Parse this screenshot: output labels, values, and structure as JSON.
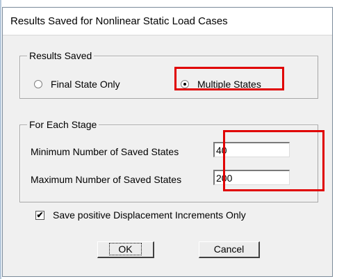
{
  "window": {
    "title": "Results Saved for Nonlinear Static Load Cases"
  },
  "results_saved": {
    "legend": "Results Saved",
    "options": [
      {
        "label": "Final State Only",
        "checked": false
      },
      {
        "label": "Multiple States",
        "checked": true
      }
    ]
  },
  "each_stage": {
    "legend": "For Each Stage",
    "min_label": "Minimum Number of Saved States",
    "min_value": "40",
    "max_label": "Maximum Number of Saved States",
    "max_value": "200"
  },
  "save_positive": {
    "label": "Save positive Displacement Increments Only",
    "checked": true,
    "mark": "✔"
  },
  "buttons": {
    "ok": "OK",
    "cancel": "Cancel"
  },
  "colors": {
    "highlight": "#e00000",
    "dialog_bg": "#f0f0f0"
  }
}
